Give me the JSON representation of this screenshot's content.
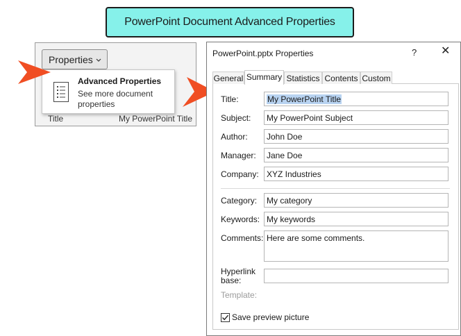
{
  "banner": {
    "title": "PowerPoint Document Advanced Properties"
  },
  "backstage": {
    "properties_button": "Properties",
    "menu": {
      "item_title": "Advanced Properties",
      "item_description": "See more document properties"
    },
    "row": {
      "label": "Title",
      "value": "My PowerPoint Title"
    }
  },
  "dialog": {
    "title": "PowerPoint.pptx Properties",
    "help_glyph": "?",
    "close_glyph": "✕",
    "tabs": [
      {
        "label": "General",
        "active": false
      },
      {
        "label": "Summary",
        "active": true
      },
      {
        "label": "Statistics",
        "active": false
      },
      {
        "label": "Contents",
        "active": false
      },
      {
        "label": "Custom",
        "active": false
      }
    ],
    "fields": {
      "title": {
        "label": "Title:",
        "value": "My PowerPoint Title"
      },
      "subject": {
        "label": "Subject:",
        "value": "My PowerPoint Subject"
      },
      "author": {
        "label": "Author:",
        "value": "John Doe"
      },
      "manager": {
        "label": "Manager:",
        "value": "Jane Doe"
      },
      "company": {
        "label": "Company:",
        "value": "XYZ Industries"
      },
      "category": {
        "label": "Category:",
        "value": "My category"
      },
      "keywords": {
        "label": "Keywords:",
        "value": "My keywords"
      },
      "comments": {
        "label": "Comments:",
        "value": "Here are some comments."
      },
      "hyperlink_base": {
        "label_line1": "Hyperlink",
        "label_line2": "base:",
        "value": ""
      },
      "template": {
        "label": "Template:",
        "value": ""
      }
    },
    "save_preview": {
      "label": "Save preview picture",
      "checked": true
    }
  },
  "colors": {
    "banner_bg": "#86f1ea",
    "arrow": "#f04e23",
    "selection": "#b8d3f1"
  },
  "icons": [
    "document-list-icon",
    "chevron-down-icon",
    "help-icon",
    "close-icon",
    "checkmark-icon",
    "callout-arrow"
  ]
}
